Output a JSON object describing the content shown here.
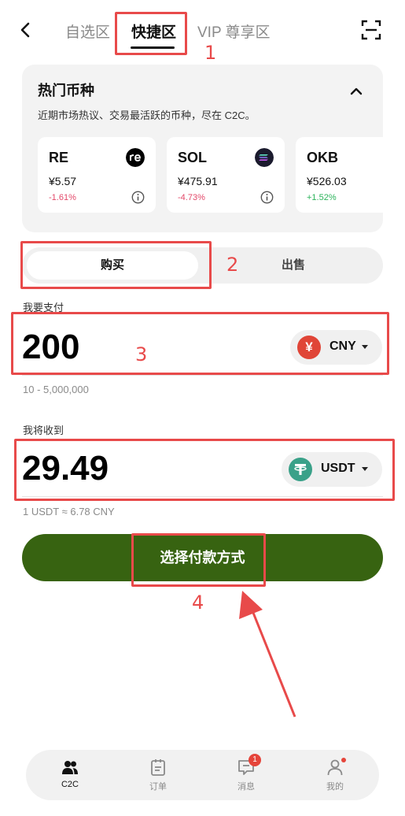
{
  "header": {
    "tabs": [
      "自选区",
      "快捷区",
      "VIP 尊享区"
    ],
    "active_tab": 1
  },
  "annotations": [
    "1",
    "2",
    "3",
    "4"
  ],
  "hot_coins": {
    "title": "热门币种",
    "subtitle": "近期市场热议、交易最活跃的币种，尽在 C2C。",
    "coins": [
      {
        "name": "RE",
        "price": "¥5.57",
        "change": "-1.61%",
        "trend": "down"
      },
      {
        "name": "SOL",
        "price": "¥475.91",
        "change": "-4.73%",
        "trend": "down"
      },
      {
        "name": "OKB",
        "price": "¥526.03",
        "change": "+1.52%",
        "trend": "up"
      }
    ]
  },
  "trade_toggle": {
    "buy_label": "购买",
    "sell_label": "出售",
    "selected": "buy"
  },
  "pay": {
    "label": "我要支付",
    "amount": "200",
    "currency": "CNY",
    "currency_symbol": "¥",
    "currency_color": "#e04537",
    "range": "10 - 5,000,000"
  },
  "receive": {
    "label": "我将收到",
    "amount": "29.49",
    "currency": "USDT",
    "currency_color": "#3aa189",
    "rate": "1 USDT ≈ 6.78 CNY"
  },
  "cta": {
    "label": "选择付款方式",
    "color": "#376311"
  },
  "bottom_nav": {
    "items": [
      {
        "label": "C2C",
        "icon": "users-icon",
        "active": true
      },
      {
        "label": "订单",
        "icon": "clipboard-icon",
        "active": false
      },
      {
        "label": "消息",
        "icon": "chat-icon",
        "active": false,
        "badge": "1"
      },
      {
        "label": "我的",
        "icon": "person-icon",
        "active": false,
        "dot": true
      }
    ]
  }
}
